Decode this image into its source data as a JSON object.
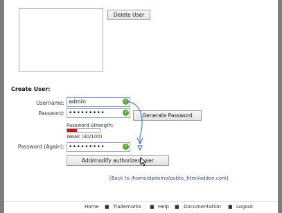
{
  "delete_button": "Delete User",
  "create_heading": "Create User:",
  "username_label": "Username:",
  "username_value": "admin",
  "password_label": "Password:",
  "password_value": "•••••••••",
  "generate_button": "Generate Password",
  "strength_label": "Password Strength:",
  "strength_fill": 0.3,
  "strength_text": "Weak (30/100)",
  "password_again_label": "Password (Again):",
  "password_again_value": "•••••••••",
  "submit_button": "Add/modify authorized user",
  "back_link": "[Back to /home/dpdemo/public_html/addon.com]",
  "footer": [
    "Home",
    "Trademarks",
    "Help",
    "Documentation",
    "Logout"
  ],
  "colors": {
    "valid": "#55aa33",
    "weak": "#cc1111",
    "annotation_arrow": "#3366cc"
  }
}
